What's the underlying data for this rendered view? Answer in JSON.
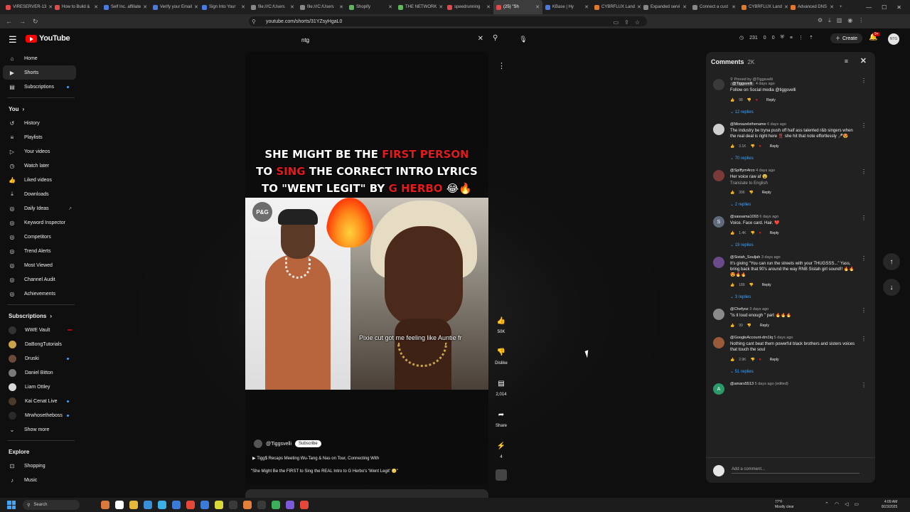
{
  "browser": {
    "tabs": [
      {
        "title": "VIRESERVER-13",
        "color": "#e04a4a"
      },
      {
        "title": "How to Build &",
        "color": "#e04a4a"
      },
      {
        "title": "Self Inc. affiliate",
        "color": "#4a7be0"
      },
      {
        "title": "Verify your Email",
        "color": "#4a7be0"
      },
      {
        "title": "Sign Into Your",
        "color": "#4a7be0"
      },
      {
        "title": "file:///C:/Users",
        "color": "#888888"
      },
      {
        "title": "file:///C:/Users",
        "color": "#888888"
      },
      {
        "title": "Shopify",
        "color": "#5db85d"
      },
      {
        "title": "THE NETWORK",
        "color": "#5db85d"
      },
      {
        "title": "speedrunning",
        "color": "#e04a4a"
      },
      {
        "title": "(25) \"Sh",
        "color": "#e04a4a",
        "active": true
      },
      {
        "title": "KBase | Hy",
        "color": "#4a7be0"
      },
      {
        "title": "CYBRFLUX Land",
        "color": "#e07a2a"
      },
      {
        "title": "Expanded servi",
        "color": "#888888"
      },
      {
        "title": "Connect a cust",
        "color": "#888888"
      },
      {
        "title": "CYBRFLUX Land",
        "color": "#e07a2a"
      },
      {
        "title": "Advanced DNS",
        "color": "#e07a2a"
      }
    ],
    "url": "youtube.com/shorts/31YZsyHgaL0"
  },
  "masthead": {
    "logo_text": "YouTube",
    "search_value": "ntg",
    "stats": [
      "231",
      "0",
      "0"
    ],
    "create_label": "Create",
    "notif_count": "9+",
    "avatar_text": "NTG"
  },
  "sidebar": {
    "main": [
      {
        "label": "Home",
        "icon": "⌂"
      },
      {
        "label": "Shorts",
        "icon": "▶",
        "active": true
      },
      {
        "label": "Subscriptions",
        "icon": "▤",
        "dot": true
      }
    ],
    "you_label": "You",
    "you": [
      {
        "label": "History",
        "icon": "↺"
      },
      {
        "label": "Playlists",
        "icon": "≡"
      },
      {
        "label": "Your videos",
        "icon": "▷"
      },
      {
        "label": "Watch later",
        "icon": "◷"
      },
      {
        "label": "Liked videos",
        "icon": "👍"
      },
      {
        "label": "Downloads",
        "icon": "⤓"
      },
      {
        "label": "Daily Ideas",
        "icon": "◎",
        "ext": true
      },
      {
        "label": "Keyword Inspector",
        "icon": "◎"
      },
      {
        "label": "Competitors",
        "icon": "◎"
      },
      {
        "label": "Trend Alerts",
        "icon": "◎"
      },
      {
        "label": "Most Viewed",
        "icon": "◎"
      },
      {
        "label": "Channel Audit",
        "icon": "◎"
      },
      {
        "label": "Achievements",
        "icon": "◎"
      }
    ],
    "subs_label": "Subscriptions",
    "subs": [
      {
        "label": "WWE Vault",
        "color": "#333333",
        "red": true
      },
      {
        "label": "DaBongTutorials",
        "color": "#c9a44a"
      },
      {
        "label": "Druski",
        "color": "#6b4a3a",
        "dot": true
      },
      {
        "label": "Daniel Bitton",
        "color": "#7a7a7a"
      },
      {
        "label": "Liam Ottley",
        "color": "#d9d9d9"
      },
      {
        "label": "Kai Cenat Live",
        "color": "#4a3a2a",
        "dot": true
      },
      {
        "label": "Mrwhosetheboss",
        "color": "#2a2a2a",
        "dot": true
      }
    ],
    "show_more": "Show more",
    "explore_label": "Explore",
    "explore": [
      {
        "label": "Shopping",
        "icon": "⊡"
      },
      {
        "label": "Music",
        "icon": "♪"
      }
    ]
  },
  "video": {
    "headline_1a": "SHE MIGHT BE THE ",
    "headline_1b": "FIRST PERSON",
    "headline_2a": "TO ",
    "headline_2b": "SING",
    "headline_2c": " THE CORRECT INTRO LYRICS",
    "headline_3a": "TO \"WENT LEGIT\" BY ",
    "headline_3b": "G HERBO",
    "headline_3c": " 😂🔥",
    "pg_badge": "P&G",
    "caption": "Pixie cut got me feeling like Auntie fr",
    "channel": "@Tiggsvelli",
    "subscribe": "Subscribe",
    "desc": "Tigg$ Recaps Meeting Wu-Tang & Nas on Tour, Connecting With",
    "title": "\"She Might Be the FIRST to Sing the REAL Intro to G Herbo's 'Went Legit' 😳\""
  },
  "actions": {
    "likes": "50K",
    "dislike": "Dislike",
    "comments": "2,014",
    "share": "Share",
    "remix": "4"
  },
  "comments": {
    "title": "Comments",
    "count": "2K",
    "items": [
      {
        "pinned": "Pinned by @Tiggsvelli",
        "user": "@Tiggsvelli",
        "time": "4 days ago",
        "text": "Follow on Social media @tiggsvelli",
        "likes": "98",
        "heart": true,
        "replies": "12 replies",
        "avatar_color": "#3a3a3a",
        "initial": "",
        "tag": true
      },
      {
        "user": "@Monazelsthename",
        "time": "6 days ago",
        "text": "The industry be tryna push off half ass talented r&b singers when the real deal is right here ‼️ she hit that note effortlessly 🎤😍",
        "likes": "3.1K",
        "heart": true,
        "replies": "70 replies",
        "avatar_color": "#cfcfcf",
        "initial": ""
      },
      {
        "user": "@Spiffym4rco",
        "time": "4 days ago",
        "text": "Her voice raw af 😮",
        "trans": "Translate to English",
        "likes": "396",
        "replies": "2 replies",
        "avatar_color": "#7a3a3a",
        "initial": ""
      },
      {
        "user": "@sassama1093",
        "time": "6 days ago",
        "text": "Voice. Face card. Hair. ❤️",
        "likes": "1.4K",
        "heart": true,
        "replies": "19 replies",
        "avatar_color": "#5f6a7a",
        "initial": "S"
      },
      {
        "user": "@Sistah_Souljah",
        "time": "3 days ago",
        "text": "It's giving \"You can run the streets with your THUGSSS...\" Yass, bring back that 90's around the way RNB Sistah girl sound!! 🔥🔥😍🔥🔥",
        "likes": "189",
        "replies": "3 replies",
        "avatar_color": "#6a4a8a",
        "initial": ""
      },
      {
        "user": "@Chefyoz",
        "time": "3 days ago",
        "text": "\"Is it loud enough \" part 🔥🔥🔥",
        "likes": "99",
        "replies": "",
        "avatar_color": "#8a8a8a",
        "initial": ""
      },
      {
        "user": "@GoogleAccount-dm1lq",
        "time": "5 days ago",
        "text": "Nothing cant beat them powerful black brothers and sisters voices that touch the soul",
        "likes": "2.9K",
        "heart": true,
        "replies": "51 replies",
        "avatar_color": "#9a5a3a",
        "initial": ""
      },
      {
        "user": "@amars5513",
        "time": "5 days ago (edited)",
        "text": "",
        "likes": "",
        "replies": "",
        "avatar_color": "#2a9a6a",
        "initial": "A"
      }
    ],
    "reply_label": "Reply",
    "add_placeholder": "Add a comment..."
  },
  "taskbar": {
    "search_placeholder": "Search",
    "weather_temp": "77°F",
    "weather_desc": "Mostly clear",
    "time": "4:09 AM",
    "date": "8/23/2025"
  }
}
